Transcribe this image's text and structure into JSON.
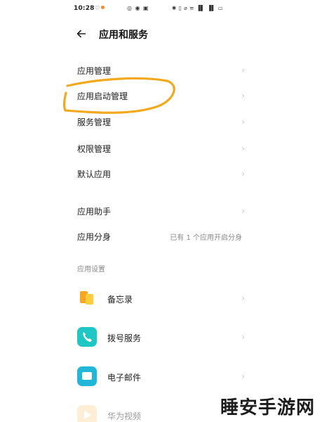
{
  "status_bar": {
    "time": "10:28",
    "left_icons": "♡",
    "mid_icons": "◎ ◉ ▣",
    "right_icons": "✱ ▯ ⌀ ≡ ▐▌ ▐▌ ▭"
  },
  "header": {
    "back_icon": "arrow-left-icon",
    "title": "应用和服务"
  },
  "rows": [
    {
      "label": "应用管理",
      "value": ""
    },
    {
      "label": "应用启动管理",
      "value": ""
    },
    {
      "label": "服务管理",
      "value": ""
    },
    {
      "label": "权限管理",
      "value": ""
    },
    {
      "label": "默认应用",
      "value": ""
    },
    {
      "label": "应用助手",
      "value": ""
    },
    {
      "label": "应用分身",
      "value": "已有 1 个应用开启分身"
    }
  ],
  "section_header": "应用设置",
  "apps": [
    {
      "label": "备忘录",
      "icon": "memo-icon"
    },
    {
      "label": "拨号服务",
      "icon": "phone-icon"
    },
    {
      "label": "电子邮件",
      "icon": "mail-icon"
    },
    {
      "label": "华为视频",
      "icon": "video-icon"
    }
  ],
  "chevron": "›",
  "annotation_color": "#f2a91e",
  "watermark": "睡安手游网"
}
